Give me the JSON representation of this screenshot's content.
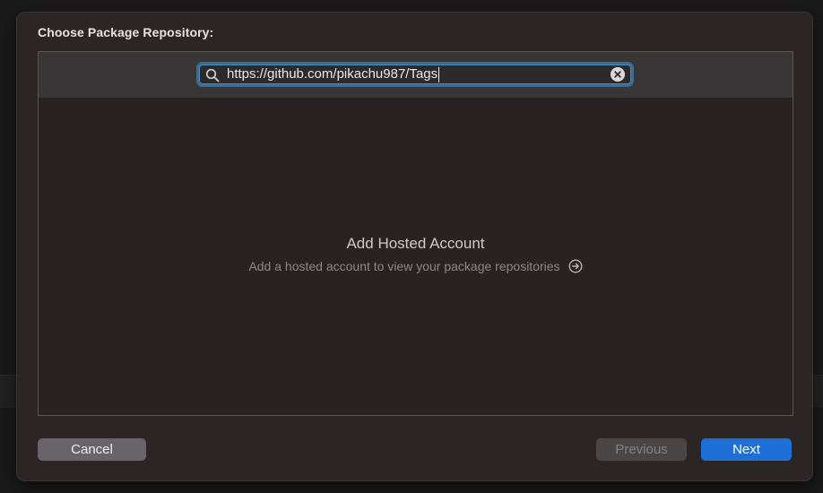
{
  "dialog": {
    "title": "Choose Package Repository:"
  },
  "search": {
    "value": "https://github.com/pikachu987/Tags",
    "placeholder": ""
  },
  "empty_state": {
    "title": "Add Hosted Account",
    "subtitle": "Add a hosted account to view your package repositories"
  },
  "buttons": {
    "cancel": "Cancel",
    "previous": "Previous",
    "next": "Next"
  },
  "icons": {
    "search": "search-icon",
    "clear": "clear-icon",
    "go": "arrow-circle-right-icon"
  },
  "colors": {
    "accent": "#1f6fd8",
    "focus_ring": "#3a6d96",
    "sheet_background": "#2b2526"
  }
}
